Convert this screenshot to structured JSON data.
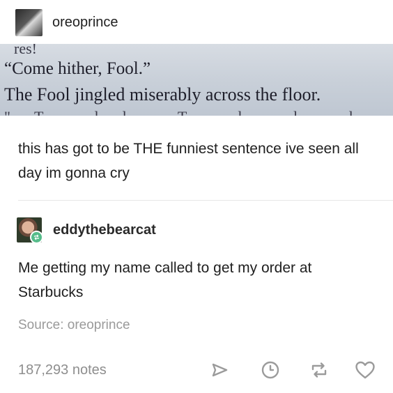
{
  "original_post": {
    "username": "oreoprince",
    "image_text": {
      "cut_top": "res!",
      "line1": "“Come hither, Fool.”",
      "line2": "The Fool jingled miserably across the floor.",
      "cut_bottom": "\"T ll T l l l \""
    },
    "caption": "this has got to be THE funniest sentence ive seen all day im gonna cry"
  },
  "reblog": {
    "username": "eddythebearcat",
    "text": "Me getting my name called to get my order at Starbucks"
  },
  "footer": {
    "source_label": "Source: oreoprince",
    "notes": "187,293 notes"
  },
  "colors": {
    "reblog_badge": "#56bc8a",
    "muted_text": "#9a9a9a",
    "icon_gray": "#9b9b9b"
  },
  "icons": [
    "share-icon",
    "clock-icon",
    "reblog-icon",
    "heart-icon"
  ]
}
